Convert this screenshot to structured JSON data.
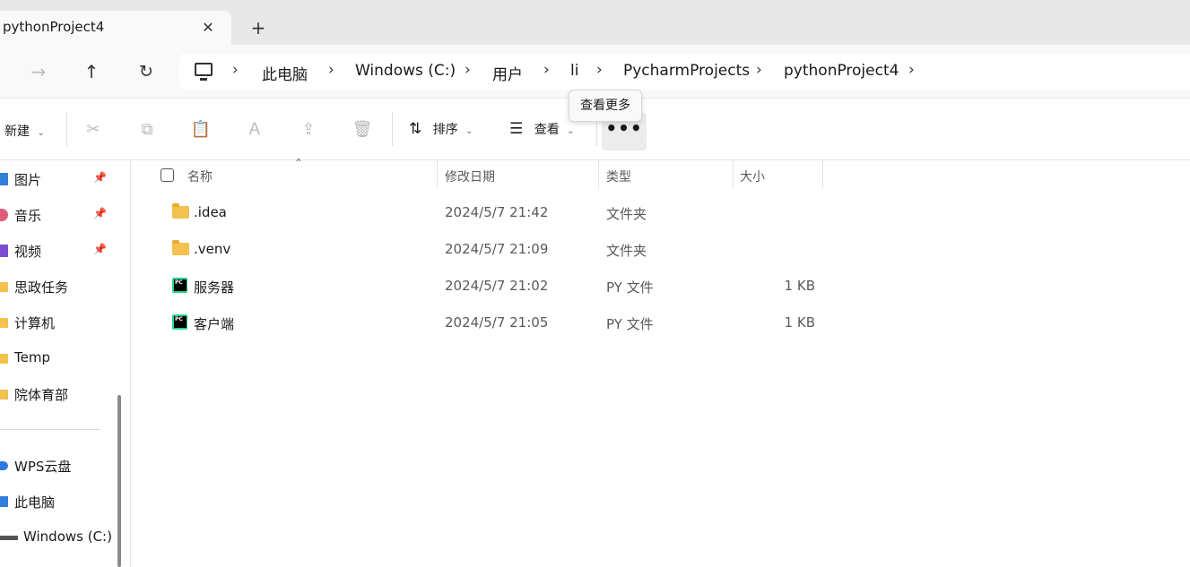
{
  "tab": {
    "title": "pythonProject4",
    "close": "✕",
    "new_tab": "+"
  },
  "nav": {
    "back": "←",
    "forward": "→",
    "up": "↑",
    "refresh": "↻",
    "breadcrumbs": [
      "此电脑",
      "Windows (C:)",
      "用户",
      "li",
      "PycharmProjects",
      "pythonProject4"
    ],
    "separator": "›"
  },
  "tooltip": "查看更多",
  "toolbar": {
    "new_label": "新建",
    "sort_label": "排序",
    "view_label": "查看",
    "more_label": "•••"
  },
  "sidebar": {
    "items": [
      {
        "label": "图片",
        "icon": "pictures-icon",
        "pinned": true,
        "color": "#2f7fd8"
      },
      {
        "label": "音乐",
        "icon": "music-icon",
        "pinned": true,
        "color": "#e05a7a"
      },
      {
        "label": "视频",
        "icon": "videos-icon",
        "pinned": true,
        "color": "#7a4fd0"
      },
      {
        "label": "思政任务",
        "icon": "folder-icon",
        "pinned": false,
        "color": "#f2c14e"
      },
      {
        "label": "计算机",
        "icon": "folder-icon",
        "pinned": false,
        "color": "#f2c14e"
      },
      {
        "label": "Temp",
        "icon": "folder-icon",
        "pinned": false,
        "color": "#f2c14e"
      },
      {
        "label": "院体育部",
        "icon": "folder-icon",
        "pinned": false,
        "color": "#f2c14e"
      }
    ],
    "items2": [
      {
        "label": "WPS云盘",
        "icon": "cloud-icon",
        "color": "#2c7be5"
      },
      {
        "label": "此电脑",
        "icon": "pc-icon",
        "color": "#2f7fd8"
      },
      {
        "label": "Windows (C:)",
        "icon": "drive-icon",
        "color": "#555555"
      }
    ]
  },
  "columns": {
    "name": "名称",
    "date": "修改日期",
    "type": "类型",
    "size": "大小"
  },
  "files": [
    {
      "name": ".idea",
      "date": "2024/5/7 21:42",
      "type": "文件夹",
      "size": "",
      "icon": "folder-icon"
    },
    {
      "name": ".venv",
      "date": "2024/5/7 21:09",
      "type": "文件夹",
      "size": "",
      "icon": "folder-icon"
    },
    {
      "name": "服务器",
      "date": "2024/5/7 21:02",
      "type": "PY 文件",
      "size": "1 KB",
      "icon": "pycharm-file-icon"
    },
    {
      "name": "客户端",
      "date": "2024/5/7 21:05",
      "type": "PY 文件",
      "size": "1 KB",
      "icon": "pycharm-file-icon"
    }
  ]
}
